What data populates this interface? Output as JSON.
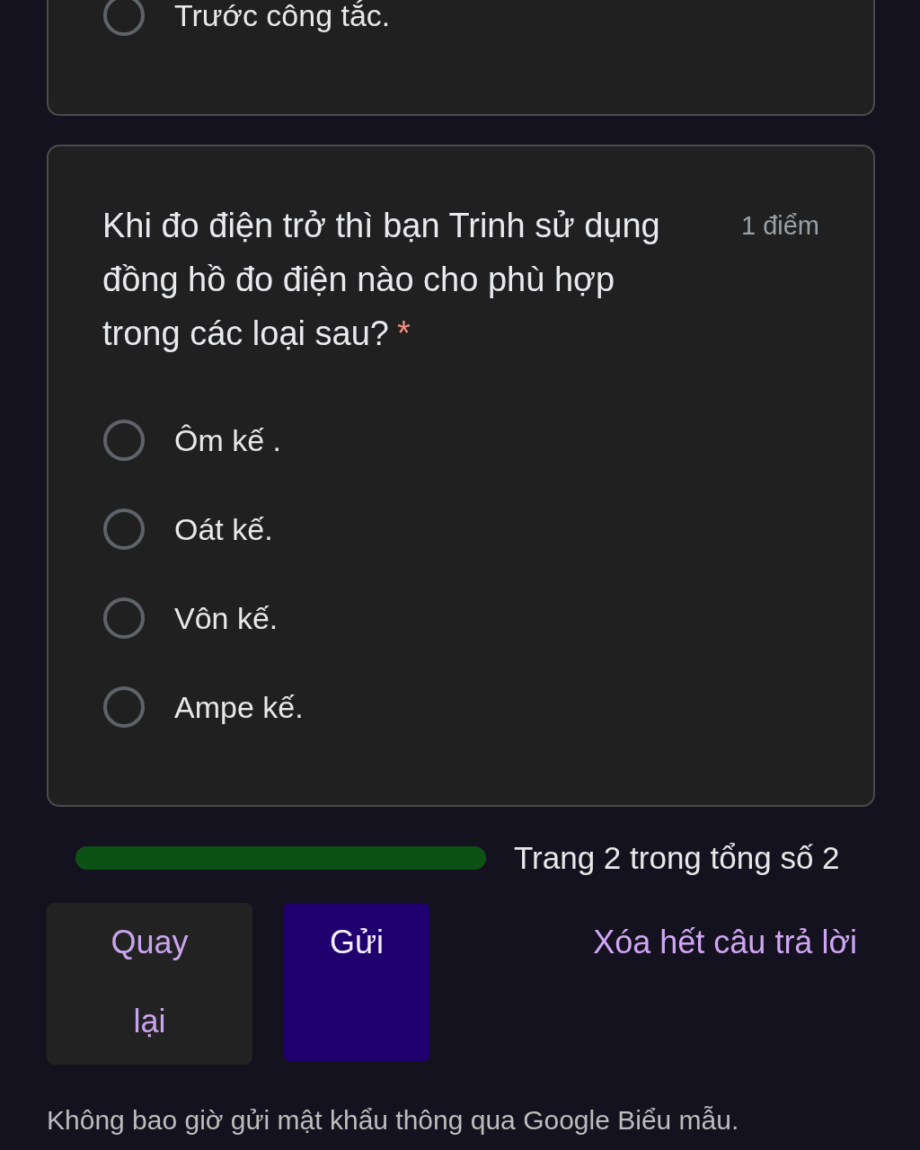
{
  "previous_question": {
    "options": [
      {
        "label": "Trước công tắc.",
        "selected": false
      }
    ]
  },
  "question": {
    "title": "Khi đo điện trở thì bạn Trinh sử dụng đồng hồ đo điện nào cho phù hợp trong các loại sau?",
    "required_mark": "*",
    "points": "1 điểm",
    "options": [
      {
        "label": "Ôm kế .",
        "selected": false
      },
      {
        "label": "Oát kế.",
        "selected": false
      },
      {
        "label": "Vôn kế.",
        "selected": false
      },
      {
        "label": "Ampe kế.",
        "selected": false
      }
    ]
  },
  "progress": {
    "level": 1,
    "label": "Trang 2 trong tổng số 2"
  },
  "buttons": [
    {
      "label": "Quay lại",
      "kind": "back"
    },
    {
      "label": "Gửi",
      "kind": "submit"
    },
    {
      "label": "Xóa hết câu trả lời",
      "kind": "clear"
    }
  ],
  "footer": "Không bao giờ gửi mật khẩu thông qua Google Biểu mẫu."
}
